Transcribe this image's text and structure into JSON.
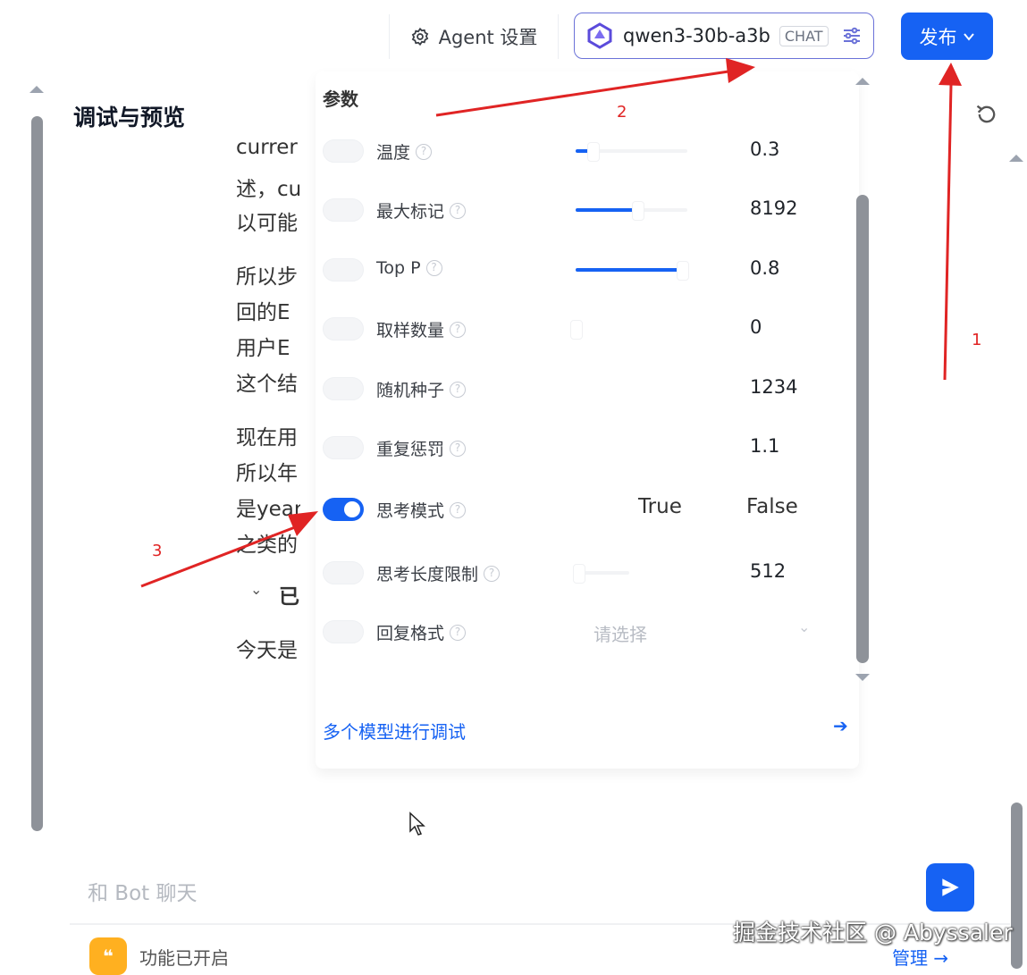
{
  "header": {
    "agent_settings_label": "Agent 设置",
    "model_name": "qwen3-30b-a3b",
    "model_tag": "CHAT",
    "publish_label": "发布"
  },
  "debug_panel": {
    "title": "调试与预览",
    "chat_lines": [
      "currer",
      "述，cu",
      "以可能",
      "所以步",
      "回的E",
      "用户E",
      "这个结",
      "现在用",
      "所以年",
      "是year",
      "之类的",
      "已",
      "今天是"
    ]
  },
  "params_popup": {
    "title": "参数",
    "params": [
      {
        "label": "温度",
        "value": "0.3",
        "enabled": false,
        "slider_percent": 15
      },
      {
        "label": "最大标记",
        "value": "8192",
        "enabled": false,
        "slider_percent": 55
      },
      {
        "label": "Top P",
        "value": "0.8",
        "enabled": false,
        "slider_percent": 95
      },
      {
        "label": "取样数量",
        "value": "0",
        "enabled": false,
        "slider_percent": 0
      },
      {
        "label": "随机种子",
        "value": "1234",
        "enabled": false
      },
      {
        "label": "重复惩罚",
        "value": "1.1",
        "enabled": false
      },
      {
        "label": "思考模式",
        "enabled": true,
        "options": [
          "True",
          "False"
        ]
      },
      {
        "label": "思考长度限制",
        "value": "512",
        "enabled": false,
        "slider_percent": 5
      },
      {
        "label": "回复格式",
        "enabled": false,
        "placeholder": "请选择"
      }
    ],
    "multi_model_link": "多个模型进行调试"
  },
  "chat_input": {
    "placeholder": "和 Bot 聊天"
  },
  "footer": {
    "feature_status": "功能已开启",
    "manage_link": "管理 →",
    "watermark": "掘金技术社区 @ Abyssaler"
  },
  "annotations": [
    "1",
    "2",
    "3"
  ],
  "colors": {
    "accent": "#1662f3",
    "annotation": "#e02424",
    "feature_icon": "#ffb020"
  }
}
